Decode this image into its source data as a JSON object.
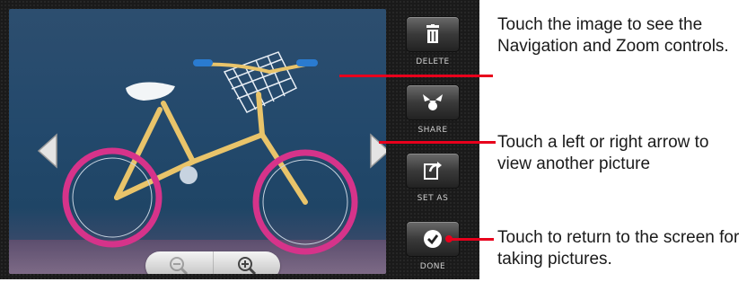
{
  "actions": {
    "delete": {
      "label": "DELETE",
      "icon": "trash-icon"
    },
    "share": {
      "label": "SHARE",
      "icon": "share-icon"
    },
    "set_as": {
      "label": "SET AS",
      "icon": "set-as-icon"
    },
    "done": {
      "label": "DONE",
      "icon": "checkmark-icon"
    }
  },
  "navigation": {
    "previous_icon": "chevron-left-icon",
    "next_icon": "chevron-right-icon"
  },
  "zoom": {
    "zoom_out_icon": "zoom-out-icon",
    "zoom_in_icon": "zoom-in-icon"
  },
  "callouts": {
    "image": "Touch the image to see the Navigation and Zoom controls.",
    "arrows": "Touch a left or right arrow to view another picture",
    "done": "Touch to return to the screen for taking pictures."
  },
  "colors": {
    "callout": "#e8001c"
  }
}
